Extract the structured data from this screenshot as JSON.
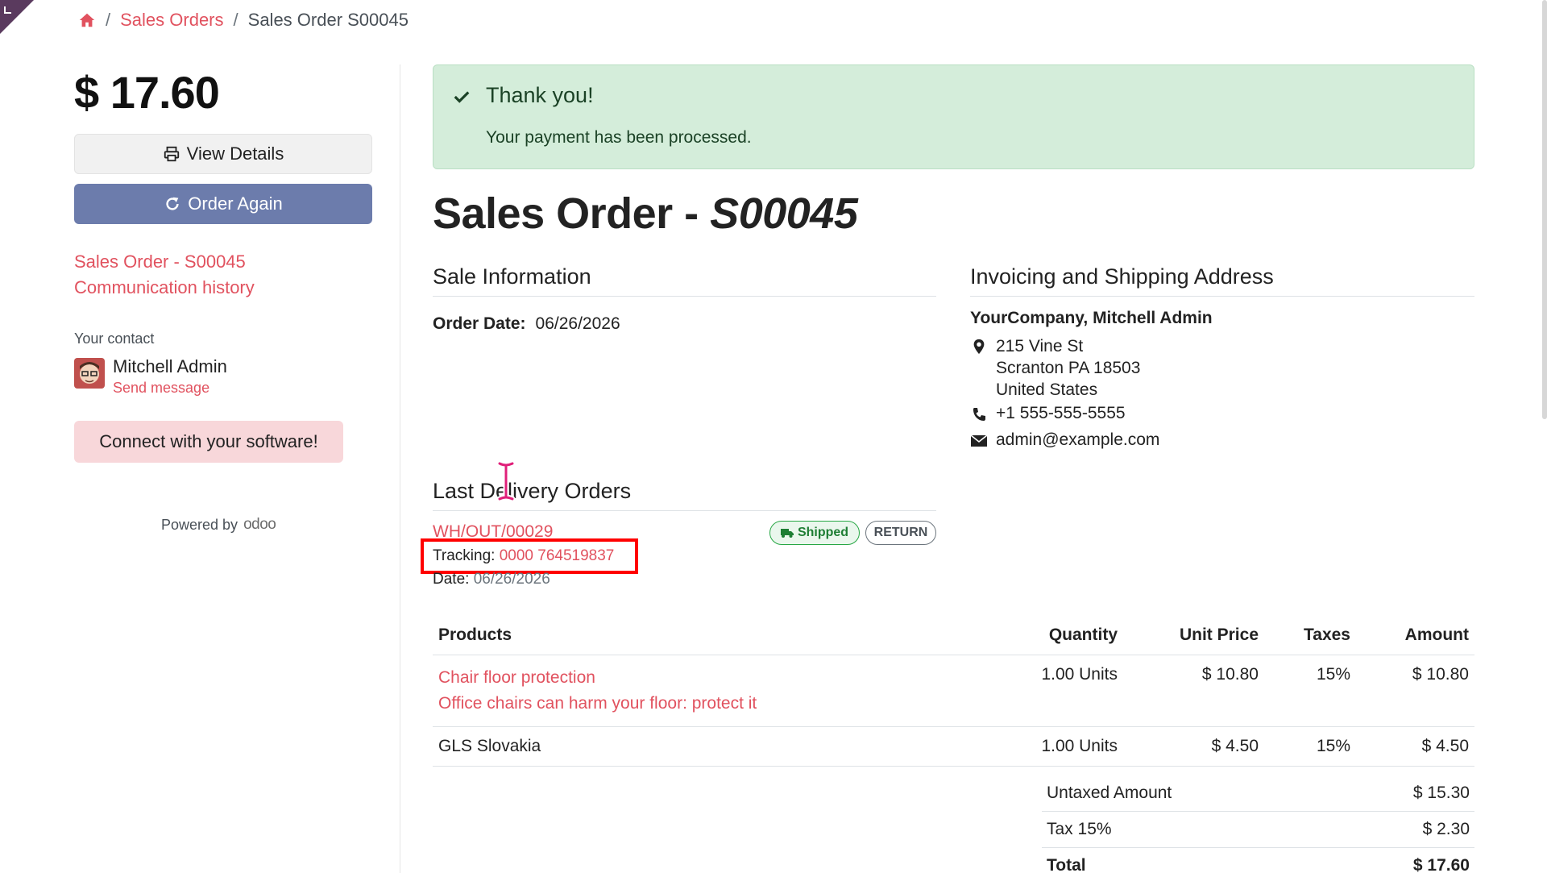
{
  "breadcrumb": {
    "home_icon": "home-icon",
    "sales_orders": "Sales Orders",
    "separator": "/",
    "current": "Sales Order S00045"
  },
  "sidebar": {
    "amount": "$ 17.60",
    "view_details": "View Details",
    "order_again": "Order Again",
    "link_order": "Sales Order - S00045",
    "link_history": "Communication history",
    "contact_label": "Your contact",
    "contact_name": "Mitchell Admin",
    "send_message": "Send message",
    "connect": "Connect with your software!",
    "powered_by": "Powered by",
    "odoo": "odoo"
  },
  "alert": {
    "title": "Thank you!",
    "text": "Your payment has been processed."
  },
  "title": {
    "prefix": "Sales Order - ",
    "ref": "S00045"
  },
  "sale_info": {
    "heading": "Sale Information",
    "order_date_label": "Order Date:",
    "order_date": "06/26/2026"
  },
  "address": {
    "heading": "Invoicing and Shipping Address",
    "name": "YourCompany, Mitchell Admin",
    "street": "215 Vine St",
    "city": "Scranton PA 18503",
    "country": "United States",
    "phone": "+1 555-555-5555",
    "email": "admin@example.com"
  },
  "delivery": {
    "heading": "Last Delivery Orders",
    "ref": "WH/OUT/00029",
    "status": "Shipped",
    "return_label": "RETURN",
    "tracking_label": "Tracking:",
    "tracking_number": "0000 764519837",
    "date_label": "Date:",
    "date": "06/26/2026"
  },
  "products": {
    "headers": [
      "Products",
      "Quantity",
      "Unit Price",
      "Taxes",
      "Amount"
    ],
    "rows": [
      {
        "name": "Chair floor protection",
        "desc": "Office chairs can harm your floor: protect it",
        "qty": "1.00 Units",
        "price": "$ 10.80",
        "tax": "15%",
        "amount": "$ 10.80"
      },
      {
        "name": "GLS Slovakia",
        "desc": "",
        "qty": "1.00 Units",
        "price": "$ 4.50",
        "tax": "15%",
        "amount": "$ 4.50"
      }
    ]
  },
  "totals": {
    "untaxed_label": "Untaxed Amount",
    "untaxed": "$ 15.30",
    "tax_label": "Tax 15%",
    "tax": "$ 2.30",
    "total_label": "Total",
    "total": "$ 17.60"
  },
  "colors": {
    "link": "#e1525f",
    "primary": "#6c7cac",
    "success_bg": "#d4edda",
    "highlight": "#ff0000"
  }
}
